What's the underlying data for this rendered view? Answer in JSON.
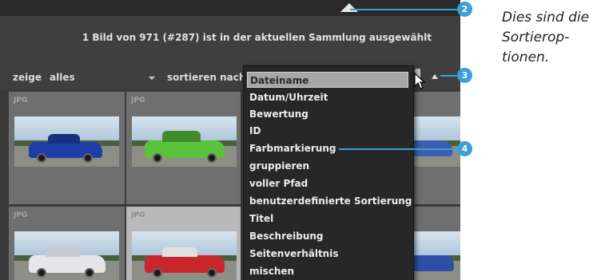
{
  "status_text": "1 Bild von 971 (#287) ist in der aktuellen Sammlung ausgewählt",
  "filter": {
    "show_label": "zeige",
    "show_value": "alles",
    "sort_label": "sortieren nach"
  },
  "sort_menu": {
    "items": [
      "Dateiname",
      "Datum/Uhrzeit",
      "Bewertung",
      "ID",
      "Farbmarkierung",
      "gruppieren",
      "voller Pfad",
      "benutzerdefinierte Sortierung",
      "Titel",
      "Beschreibung",
      "Seitenverhältnis",
      "mischen"
    ],
    "highlighted_index": 0
  },
  "thumbnails": [
    {
      "badge": "JPG"
    },
    {
      "badge": "JPG"
    },
    {
      "badge": "JPG"
    },
    {
      "badge": "JPG"
    }
  ],
  "callouts": {
    "c2": "2",
    "c3": "3",
    "c4": "4"
  },
  "description": [
    "Dies sind die",
    "Sortierop-",
    "tionen."
  ],
  "colors": {
    "accent": "#3aa0d8",
    "background": "#3f3f3f",
    "menu": "#272727"
  }
}
